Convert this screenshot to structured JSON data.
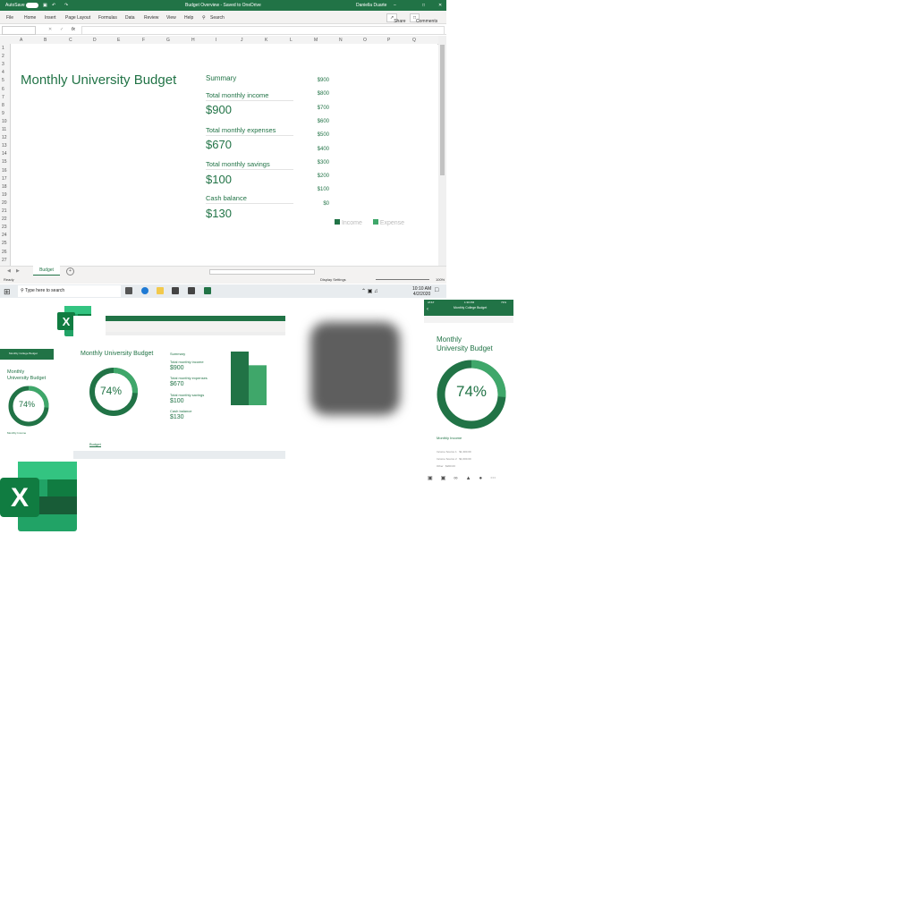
{
  "window": {
    "autosave_label": "AutoSave",
    "title": "Budget Overview - Saved to OneDrive",
    "user": "Daniella Duarte",
    "share_label": "Share",
    "comments_label": "Comments"
  },
  "ribbon": {
    "tabs": [
      "File",
      "Home",
      "Insert",
      "Page Layout",
      "Formulas",
      "Data",
      "Review",
      "View",
      "Help"
    ],
    "search_label": "Search"
  },
  "formula_bar": {
    "name_box": "",
    "fx_label": "fx"
  },
  "columns": [
    "A",
    "B",
    "C",
    "D",
    "E",
    "F",
    "G",
    "H",
    "I",
    "J",
    "K",
    "L",
    "M",
    "N",
    "O",
    "P",
    "Q"
  ],
  "rows": [
    "1",
    "2",
    "3",
    "4",
    "5",
    "6",
    "7",
    "8",
    "9",
    "10",
    "11",
    "12",
    "13",
    "14",
    "15",
    "16",
    "17",
    "18",
    "19",
    "20",
    "21",
    "22",
    "23",
    "24",
    "25",
    "26",
    "27"
  ],
  "sheet": {
    "title": "Monthly University Budget",
    "summary_heading": "Summary",
    "income_label": "Total monthly income",
    "income_value": "$900",
    "expenses_label": "Total monthly expenses",
    "expenses_value": "$670",
    "savings_label": "Total monthly savings",
    "savings_value": "$100",
    "cash_label": "Cash balance",
    "cash_value": "$130"
  },
  "chart_data": {
    "type": "bar",
    "categories": [
      ""
    ],
    "series": [
      {
        "name": "Income",
        "values": [
          900
        ]
      },
      {
        "name": "Expense",
        "values": [
          670
        ]
      }
    ],
    "yticks": [
      "$900",
      "$800",
      "$700",
      "$600",
      "$500",
      "$400",
      "$300",
      "$200",
      "$100",
      "$0"
    ],
    "ylim": [
      0,
      900
    ],
    "legend": [
      "Income",
      "Expense"
    ],
    "colors": {
      "income": "#217346",
      "expense": "#3fa76a"
    }
  },
  "tabs": {
    "sheet_tab": "Budget",
    "add_sheet": "+"
  },
  "status": {
    "ready": "Ready",
    "display_settings": "Display Settings",
    "zoom": "100%"
  },
  "taskbar": {
    "search_placeholder": "Type here to search",
    "time": "10:10 AM",
    "date": "4/2/2020"
  },
  "laptop": {
    "title": "Monthly University Budget",
    "donut": "74%",
    "summary": "Summary",
    "income_label": "Total monthly income",
    "income_value": "$900",
    "expenses_label": "Total monthly expenses",
    "expenses_value": "$670",
    "savings_label": "Total monthly savings",
    "savings_value": "$100",
    "cash_label": "Cash balance",
    "cash_value": "$130",
    "sheet_tab": "Budget"
  },
  "phone_left": {
    "header": "Monthly College Budget",
    "title_line1": "Monthly",
    "title_line2": "University Budget",
    "donut": "74%",
    "section": "Monthly Income"
  },
  "phone_right": {
    "status_left": "AT&T",
    "status_time": "1:30 PM",
    "status_right": "73%",
    "header": "Monthly College Budget",
    "title_line1": "Monthly",
    "title_line2": "University Budget",
    "donut": "74%",
    "section": "Monthly Income",
    "rows": [
      {
        "label": "Income Source 1",
        "value": "$1,300.00"
      },
      {
        "label": "Income Source 2",
        "value": "$1,000.00"
      },
      {
        "label": "Other",
        "value": "$200.00"
      }
    ]
  },
  "colors": {
    "excel_green": "#217346",
    "accent_green": "#3fa76a"
  }
}
